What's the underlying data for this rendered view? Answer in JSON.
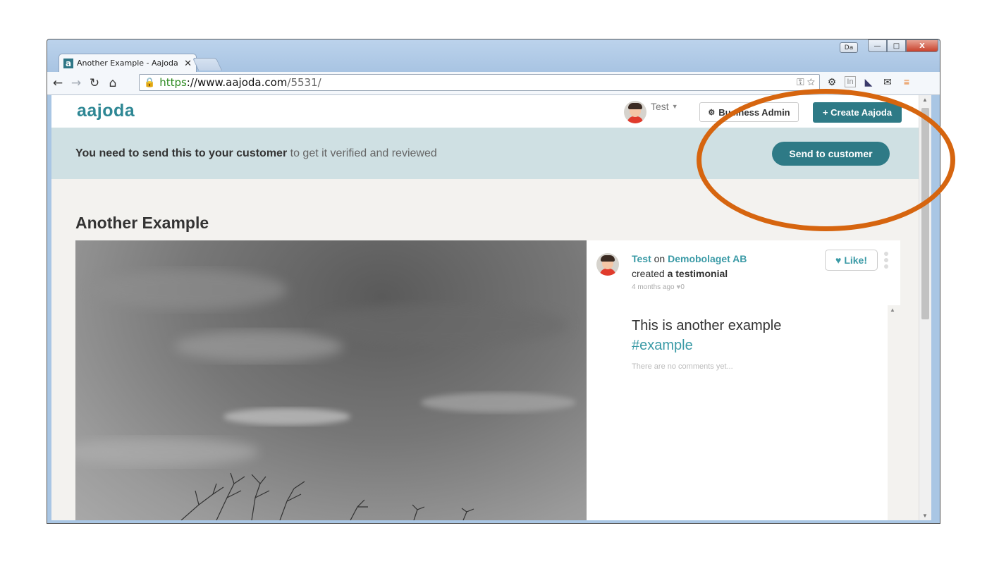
{
  "browser": {
    "tab_title": "Another Example - Aajoda",
    "tab_close": "✕",
    "url_scheme": "https",
    "url_host": "://www.aajoda.com",
    "url_path": "/5531/",
    "window_badge": "Da",
    "win_min": "—",
    "win_max": "□",
    "win_close": "X"
  },
  "site": {
    "logo": "aajoda",
    "user_name": "Test",
    "business_admin_label": "Business Admin",
    "create_label": "+ Create Aajoda"
  },
  "notice": {
    "bold": "You need to send this to your customer",
    "rest": " to get it verified and reviewed",
    "send_button": "Send to customer"
  },
  "post": {
    "title": "Another Example",
    "author": "Test",
    "on_word": "on",
    "company": "Demobolaget AB",
    "action_prefix": "created ",
    "action_object": "a testimonial",
    "time": "4 months ago",
    "likes": "0",
    "like_button": "Like!",
    "body_text": "This is another example",
    "hashtag": "#example",
    "no_comments": "There are no comments yet..."
  },
  "colors": {
    "accent": "#2e7a86",
    "link": "#3a9aa6",
    "highlight_ring": "#d6650f",
    "notice_bg": "#cfe0e3"
  },
  "icons": [
    "back-icon",
    "forward-icon",
    "reload-icon",
    "home-icon",
    "lock-icon",
    "key-icon",
    "star-icon",
    "gear-icon",
    "extension-icon",
    "mail-icon",
    "menu-icon",
    "heart-icon",
    "caret-down-icon"
  ]
}
